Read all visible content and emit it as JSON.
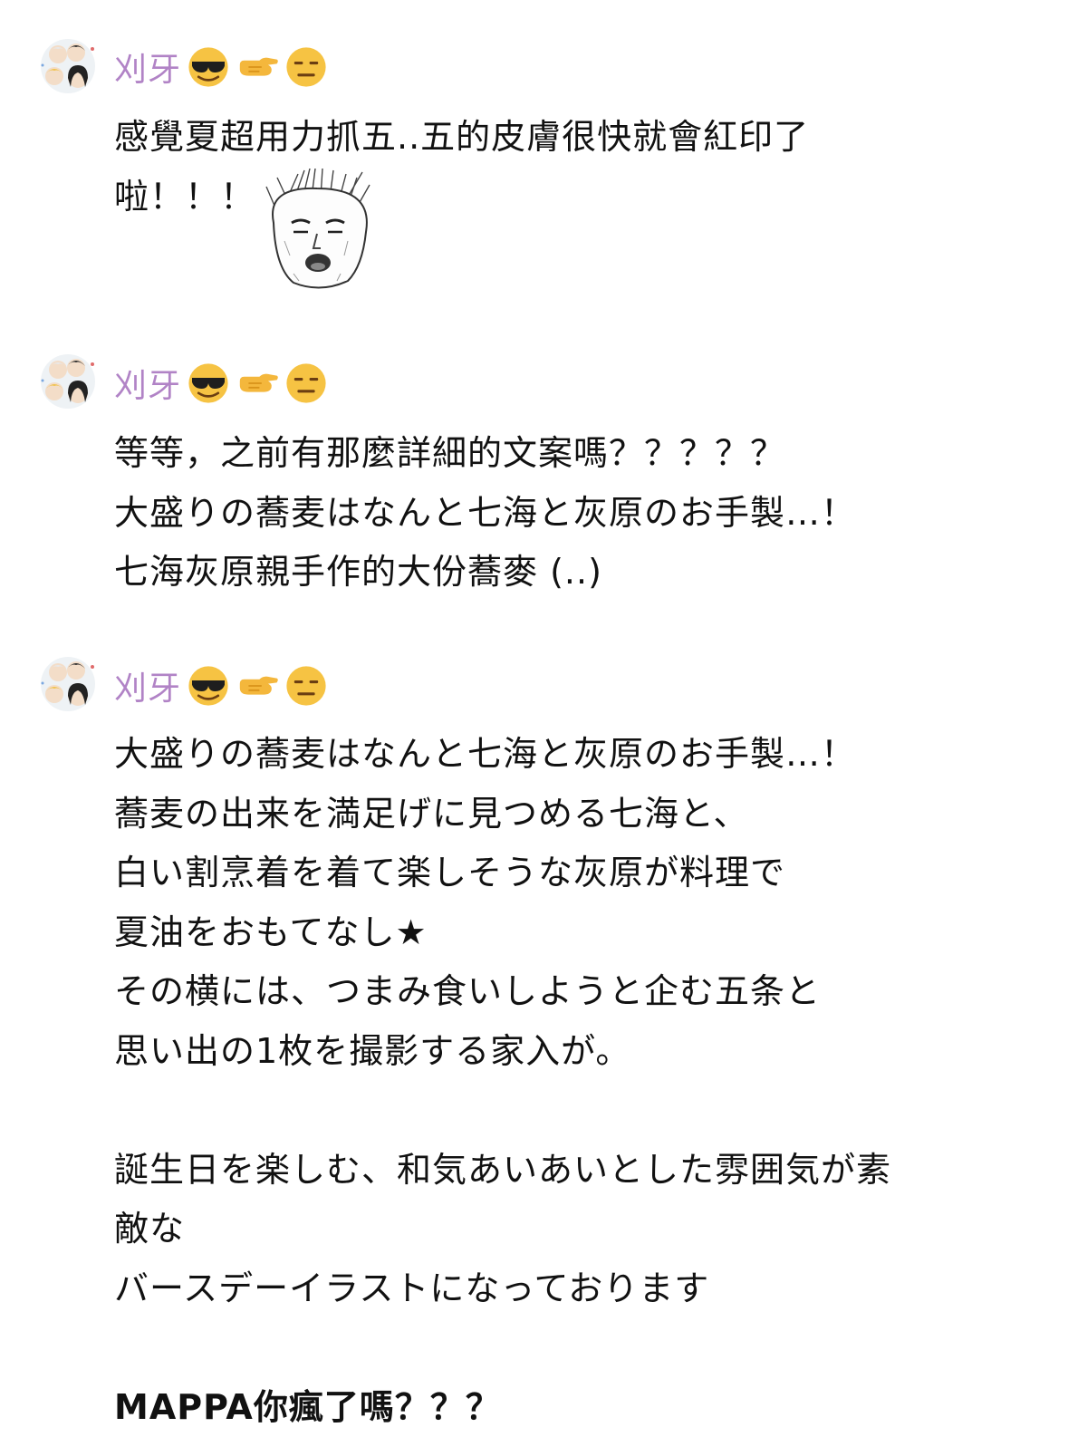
{
  "messages": [
    {
      "sender": "刈牙",
      "lines": [
        "感覺夏超用力抓五..五的皮膚很快就會紅印了",
        "啦！！！"
      ],
      "has_sticker": true
    },
    {
      "sender": "刈牙",
      "lines": [
        "等等，之前有那麼詳細的文案嗎？？？？？",
        "大盛りの蕎麦はなんと七海と灰原のお手製…！",
        "七海灰原親手作的大份蕎麥 (..)"
      ]
    },
    {
      "sender": "刈牙",
      "lines": [
        "大盛りの蕎麦はなんと七海と灰原のお手製…！",
        "蕎麦の出来を満足げに見つめる七海と、",
        "白い割烹着を着て楽しそうな灰原が料理で",
        "夏油をおもてなし★",
        "その横には、つまみ食いしようと企む五条と",
        "思い出の1枚を撮影する家入が。",
        "",
        "誕生日を楽しむ、和気あいあいとした雰囲気が素",
        "敵な",
        "バースデーイラストになっております",
        "",
        "MAPPA你瘋了嗎？？？"
      ]
    }
  ],
  "sender_emojis": [
    "smiling-face-with-sunglasses-icon",
    "backhand-index-pointing-left-icon",
    "expressionless-face-icon"
  ],
  "colors": {
    "sender_name": "#b183c6",
    "text": "#111111",
    "background": "#ffffff"
  }
}
